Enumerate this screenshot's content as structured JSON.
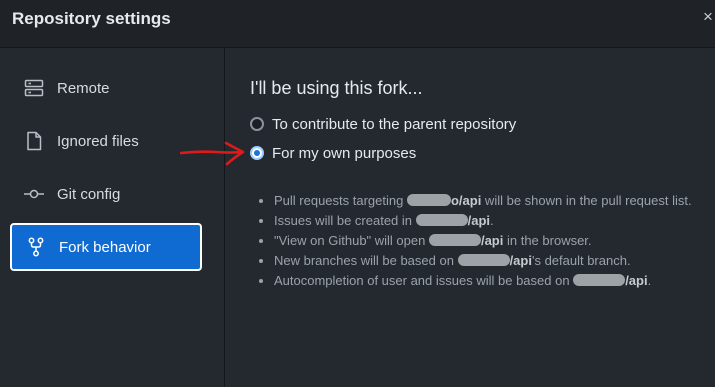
{
  "window": {
    "title": "Repository settings",
    "close_glyph": "×"
  },
  "sidebar": {
    "items": [
      {
        "label": "Remote",
        "icon": "server-icon",
        "active": false
      },
      {
        "label": "Ignored files",
        "icon": "file-icon",
        "active": false
      },
      {
        "label": "Git config",
        "icon": "git-commit-icon",
        "active": false
      },
      {
        "label": "Fork behavior",
        "icon": "fork-icon",
        "active": true
      }
    ]
  },
  "content": {
    "heading": "I'll be using this fork...",
    "options": [
      {
        "label": "To contribute to the parent repository",
        "checked": false
      },
      {
        "label": "For my own purposes",
        "checked": true
      }
    ],
    "notes": [
      {
        "before": "Pull requests targeting ",
        "repo": "o/api",
        "after": " will be shown in the pull request list."
      },
      {
        "before": "Issues will be created in ",
        "repo": "/api",
        "after": "."
      },
      {
        "before": "\"View on Github\" will open ",
        "repo": "/api",
        "after": " in the browser."
      },
      {
        "before": "New branches will be based on ",
        "repo": "/api",
        "after": "'s default branch."
      },
      {
        "before": "Autocompletion of user and issues will be based on ",
        "repo": "/api",
        "after": "."
      }
    ]
  },
  "colors": {
    "accent": "#0f6ad2",
    "annotation": "#e0191b",
    "background": "#24292f"
  }
}
